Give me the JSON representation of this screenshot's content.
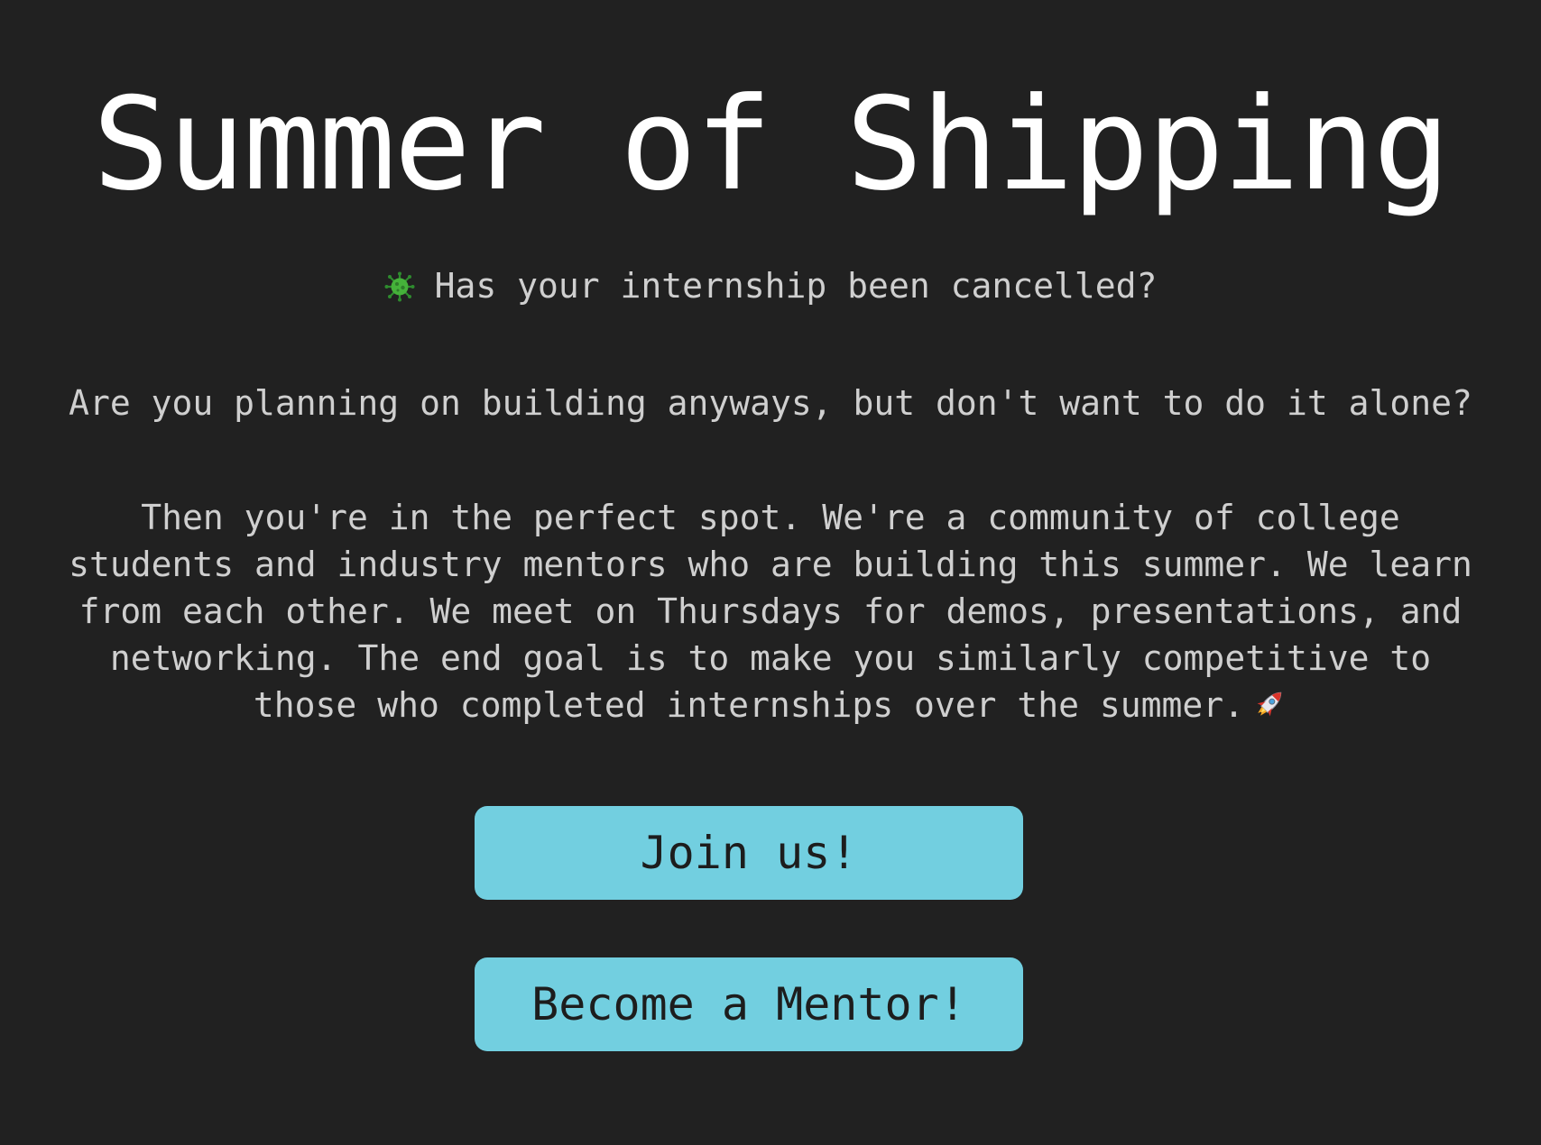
{
  "hero": {
    "title": "Summer of Shipping",
    "subtitle": "Has your internship been cancelled?",
    "subtitle_icon": "virus-icon",
    "question": "Are you planning on building anyways, but don't want to do it alone?",
    "body_lines": [
      "Then you're in the perfect spot. We're a community of college",
      "students and industry mentors who are building this summer. We learn",
      "from each other. We meet on Thursdays for demos, presentations, and",
      "networking. The end goal is to make you similarly competitive to",
      "those who completed internships over the summer."
    ],
    "body_end_icon": "rocket-icon"
  },
  "actions": {
    "join_label": "Join us!",
    "mentor_label": "Become a Mentor!"
  },
  "colors": {
    "background": "#212121",
    "title": "#ffffff",
    "text": "#cfcfcf",
    "button": "#72cfe0",
    "button_text": "#1d1d1d"
  }
}
